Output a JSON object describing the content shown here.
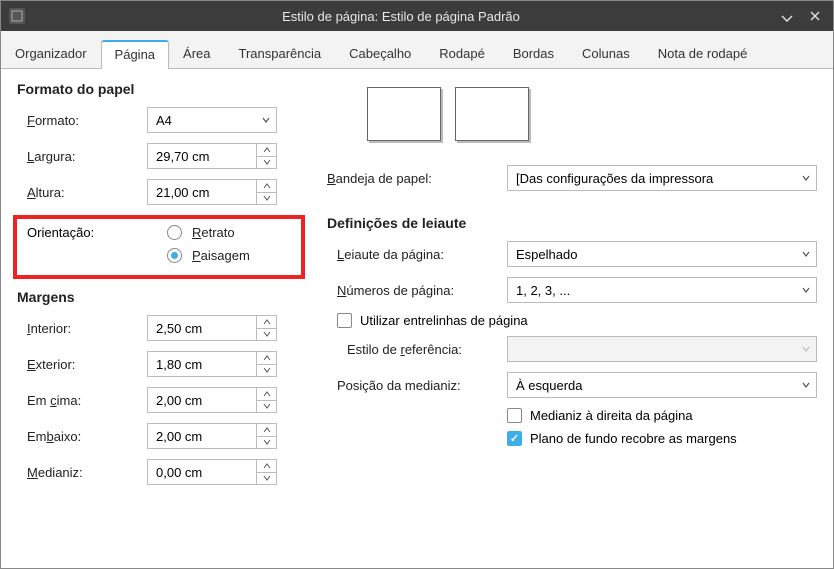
{
  "window": {
    "title": "Estilo de página: Estilo de página Padrão"
  },
  "tabs": [
    "Organizador",
    "Página",
    "Área",
    "Transparência",
    "Cabeçalho",
    "Rodapé",
    "Bordas",
    "Colunas",
    "Nota de rodapé"
  ],
  "active_tab": 1,
  "paper": {
    "section": "Formato do papel",
    "format_label": "Formato:",
    "format_u": "F",
    "format_value": "A4",
    "width_label": "Largura:",
    "width_u": "L",
    "width_value": "29,70 cm",
    "height_label": "Altura:",
    "height_u": "A",
    "height_value": "21,00 cm",
    "orient_label": "Orientação:",
    "orient_u": "O",
    "portrait": "Retrato",
    "portrait_u": "R",
    "landscape": "Paisagem",
    "landscape_u": "P",
    "tray_label": "Bandeja de papel:",
    "tray_u": "B",
    "tray_value": "[Das configurações da impressora"
  },
  "margins": {
    "section": "Margens",
    "inner_label": "Interior:",
    "inner_u": "I",
    "inner_value": "2,50 cm",
    "outer_label": "Exterior:",
    "outer_u": "E",
    "outer_value": "1,80 cm",
    "top_label": "Em cima:",
    "top_u": "c",
    "top_value": "2,00 cm",
    "bottom_label": "Embaixo:",
    "bottom_u": "b",
    "bottom_value": "2,00 cm",
    "gutter_label": "Medianiz:",
    "gutter_u": "M",
    "gutter_value": "0,00 cm"
  },
  "layout": {
    "section": "Definições de leiaute",
    "page_layout_label": "Leiaute da página:",
    "page_layout_u": "L",
    "page_layout_value": "Espelhado",
    "numbers_label": "Números de página:",
    "numbers_u": "N",
    "numbers_value": "1, 2, 3, ...",
    "register_cb": "Utilizar entrelinhas de página",
    "register_u": "U",
    "ref_style_label": "Estilo de referência:",
    "ref_u": "r",
    "gutter_pos_label": "Posição da medianiz:",
    "gutter_pos_value": "À esquerda",
    "gutter_right_cb": "Medianiz à direita da página",
    "bg_cb": "Plano de fundo recobre as margens"
  }
}
